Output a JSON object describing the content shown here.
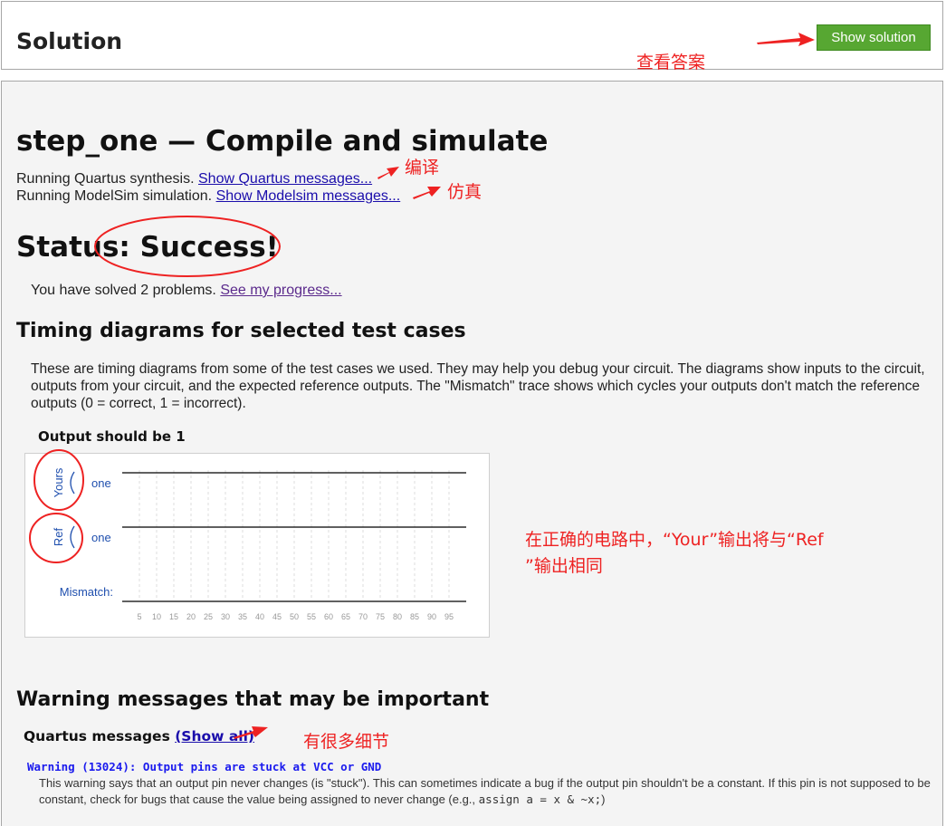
{
  "solution_panel": {
    "title": "Solution",
    "show_solution_label": "Show solution"
  },
  "main": {
    "title": "step_one — Compile and simulate",
    "quartus_line": "Running Quartus synthesis.",
    "quartus_link": "Show Quartus messages...",
    "modelsim_line": "Running ModelSim simulation.",
    "modelsim_link": "Show Modelsim messages...",
    "status": "Status: Success!",
    "solved_text": "You have solved 2 problems.",
    "progress_link": "See my progress...",
    "timing_heading": "Timing diagrams for selected test cases",
    "timing_description": "These are timing diagrams from some of the test cases we used. They may help you debug your circuit. The diagrams show inputs to the circuit, outputs from your circuit, and the expected reference outputs. The \"Mismatch\" trace shows which cycles your outputs don't match the reference outputs (0 = correct, 1 = incorrect).",
    "warning_heading": "Warning messages that may be important",
    "quartus_messages_label": "Quartus messages",
    "show_all_link": "(Show all)",
    "warning_title": "Warning (13024): Output pins are stuck at VCC or GND",
    "warning_text_a": "This warning says that an output pin never changes (is \"stuck\"). This can sometimes indicate a bug if the output pin shouldn't be a constant. If this pin is not supposed to be constant, check for bugs that cause the value being assigned to never change (e.g., ",
    "warning_code": "assign a = x & ~x;",
    "warning_text_b": ")"
  },
  "chart_data": {
    "type": "timing",
    "title": "Output should be 1",
    "groups": [
      "Yours",
      "Ref"
    ],
    "signals": [
      {
        "group": "Yours",
        "name": "one",
        "value": 1
      },
      {
        "group": "Ref",
        "name": "one",
        "value": 1
      },
      {
        "group": "",
        "name": "Mismatch:",
        "value": 0
      }
    ],
    "x_ticks": [
      5,
      10,
      15,
      20,
      25,
      30,
      35,
      40,
      45,
      50,
      55,
      60,
      65,
      70,
      75,
      80,
      85,
      90,
      95
    ],
    "xlim": [
      0,
      100
    ],
    "grid": true
  },
  "annotations": {
    "view_answer": "查看答案",
    "compile": "编译",
    "simulate": "仿真",
    "outputs_same_line1": "在正确的电路中，“Your”输出将与“Ref",
    "outputs_same_line2": "”输出相同",
    "many_details": "有很多细节"
  },
  "colors": {
    "accent_green": "#57a732",
    "annotation_red": "#ee2222",
    "trace_blue": "#1f4fae",
    "link": "#1a0dab"
  }
}
